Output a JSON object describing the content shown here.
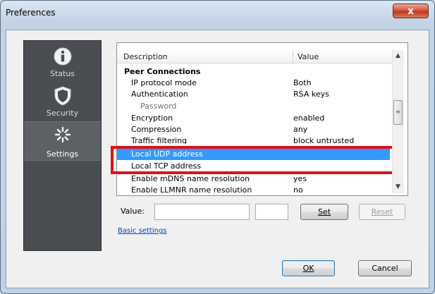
{
  "window": {
    "title": "Preferences",
    "close_label": "x"
  },
  "nav": {
    "items": [
      {
        "label": "Status",
        "icon": "info-icon"
      },
      {
        "label": "Security",
        "icon": "shield-icon"
      },
      {
        "label": "Settings",
        "icon": "settings-icon",
        "selected": true
      }
    ]
  },
  "table": {
    "headers": {
      "description": "Description",
      "value": "Value"
    },
    "rows": [
      {
        "description": "Peer Connections",
        "value": "",
        "kind": "group"
      },
      {
        "description": "IP protocol mode",
        "value": "Both"
      },
      {
        "description": "Authentication",
        "value": "RSA keys"
      },
      {
        "description": "Password",
        "value": "",
        "kind": "sub"
      },
      {
        "description": "Encryption",
        "value": "enabled"
      },
      {
        "description": "Compression",
        "value": "any"
      },
      {
        "description": "Traffic filtering",
        "value": "block untrusted"
      },
      {
        "description": "Local UDP address",
        "value": "",
        "selected": true
      },
      {
        "description": "Local TCP address",
        "value": ""
      },
      {
        "description": "Enable mDNS name resolution",
        "value": "yes"
      },
      {
        "description": "Enable LLMNR name resolution",
        "value": "no"
      }
    ]
  },
  "editor": {
    "value_label": "Value:",
    "value_text": "",
    "value_text2": "",
    "set_label": "Set",
    "reset_label": "Reset",
    "basic_link": "Basic settings"
  },
  "footer": {
    "ok_label": "OK",
    "cancel_label": "Cancel"
  },
  "colors": {
    "selection": "#3399ff",
    "highlight_box": "#e2101a",
    "nav_bg": "#4a4d51"
  }
}
